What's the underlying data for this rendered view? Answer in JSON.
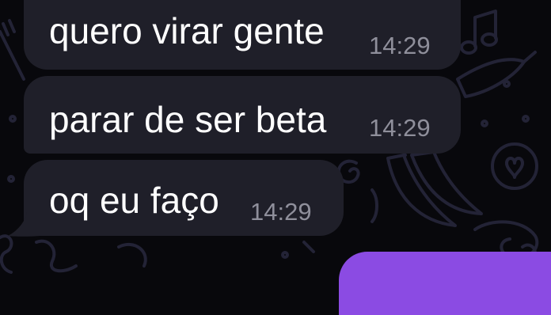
{
  "chat": {
    "messages": [
      {
        "text": "quero virar gente",
        "time": "14:29"
      },
      {
        "text": "parar de ser beta",
        "time": "14:29"
      },
      {
        "text": "oq eu faço",
        "time": "14:29"
      }
    ]
  },
  "colors": {
    "background": "#08080c",
    "incoming_bubble": "#1f1f29",
    "outgoing_bubble": "#8b4be3",
    "time_text": "#8f8f9b",
    "doodle_stroke": "#232336"
  },
  "wallpaper_icons": [
    "music-note-icon",
    "banana-icon",
    "heart-icon",
    "chili-pepper-icon",
    "spiral-icon",
    "snail-icon",
    "fork-icon",
    "scribble-icon"
  ]
}
